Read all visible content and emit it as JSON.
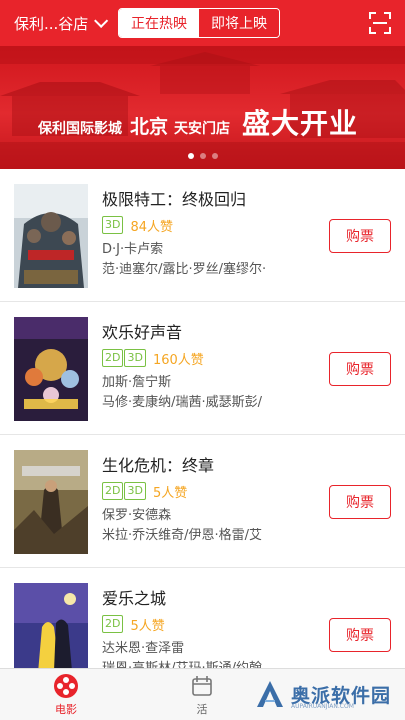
{
  "header": {
    "cinema": "保利...谷店",
    "tabs": [
      {
        "label": "正在热映",
        "active": true
      },
      {
        "label": "即将上映",
        "active": false
      }
    ],
    "scan_icon": "scan-icon"
  },
  "banner": {
    "brand": "保利国际影城",
    "city": "北京",
    "store": "天安门店",
    "slogan": "盛大开业",
    "page_count": 3,
    "active_page": 1
  },
  "movies": [
    {
      "title": "极限特工：终极回归",
      "formats": [
        "3D"
      ],
      "likes": "84人赞",
      "director": "D·J·卡卢索",
      "cast": "范·迪塞尔/露比·罗丝/塞缪尔·",
      "buy": "购票"
    },
    {
      "title": "欢乐好声音",
      "formats": [
        "2D",
        "3D"
      ],
      "likes": "160人赞",
      "director": "加斯·詹宁斯",
      "cast": "马修·麦康纳/瑞茜·威瑟斯彭/",
      "buy": "购票"
    },
    {
      "title": "生化危机：终章",
      "formats": [
        "2D",
        "3D"
      ],
      "likes": "5人赞",
      "director": "保罗·安德森",
      "cast": "米拉·乔沃维奇/伊恩·格雷/艾",
      "buy": "购票"
    },
    {
      "title": "爱乐之城",
      "formats": [
        "2D"
      ],
      "likes": "5人赞",
      "director": "达米恩·查泽雷",
      "cast": "瑞恩·高斯林/艾玛·斯通/约翰",
      "buy": "购票"
    }
  ],
  "bottom_nav": {
    "items": [
      {
        "label": "电影",
        "icon": "film-reel-icon",
        "active": true
      },
      {
        "label": "活",
        "icon": "activity-icon",
        "active": false
      }
    ]
  },
  "watermark": {
    "text": "奥派软件园",
    "sub": "AUPAIRUANJIAN.COM"
  },
  "colors": {
    "brand": "#e8242b",
    "format_tag": "#7ac143",
    "likes": "#f5a623"
  }
}
